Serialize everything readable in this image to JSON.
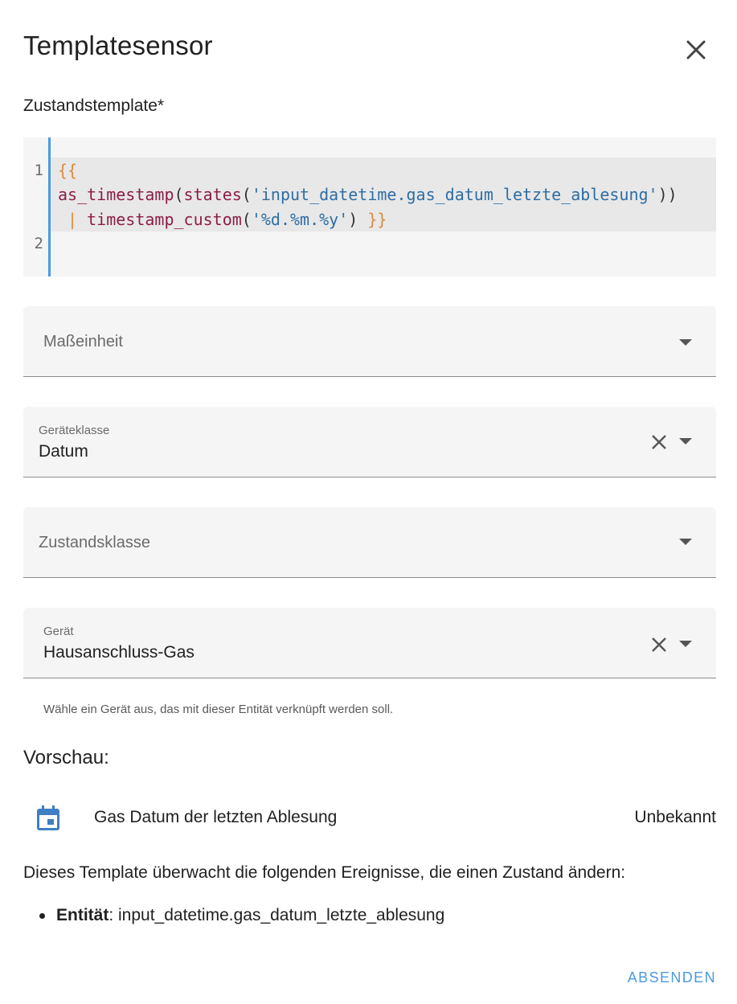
{
  "dialog": {
    "title": "Templatesensor",
    "close_icon": "close-icon"
  },
  "state_template": {
    "label": "Zustandstemplate*",
    "line_numbers": [
      "1",
      "2"
    ],
    "code": {
      "open_brace": "{{",
      "fn1": "as_timestamp",
      "fn2": "states",
      "string1": "'input_datetime.gas_datum_letzte_ablesung'",
      "pipe": "|",
      "fn3": "timestamp_custom",
      "string2": "'%d.%m.%y'",
      "close_brace": "}}"
    }
  },
  "unit_select": {
    "placeholder": "Maßeinheit"
  },
  "device_class_select": {
    "label": "Geräteklasse",
    "value": "Datum"
  },
  "state_class_select": {
    "placeholder": "Zustandsklasse"
  },
  "device_select": {
    "label": "Gerät",
    "value": "Hausanschluss-Gas",
    "helper": "Wähle ein Gerät aus, das mit dieser Entität verknüpft werden soll."
  },
  "preview": {
    "heading": "Vorschau:",
    "icon": "calendar-icon",
    "entity_name": "Gas Datum der letzten Ablesung",
    "entity_state": "Unbekannt"
  },
  "listeners": {
    "description": "Dieses Template überwacht die folgenden Ereignisse, die einen Zustand ändern:",
    "items": [
      {
        "kind": "Entität",
        "value": ": input_datetime.gas_datum_letzte_ablesung"
      }
    ]
  },
  "actions": {
    "submit_label": "ABSENDEN"
  },
  "colors": {
    "accent": "#4a9ae3",
    "field_bg": "#f5f5f5",
    "icon_blue": "#3f7fc4"
  }
}
